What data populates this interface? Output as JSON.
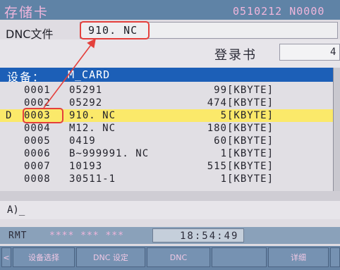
{
  "header": {
    "title": "存储卡",
    "program_no": "0510212 N0000"
  },
  "dnc": {
    "label": "DNC文件",
    "value": "910. NC"
  },
  "login": {
    "label": "登录书",
    "value": "4"
  },
  "device": {
    "label": "设备：",
    "name": "M_CARD"
  },
  "files": [
    {
      "mark": "",
      "num": "0001",
      "name": "05291",
      "size": "99",
      "unit": "[KBYTE]",
      "selected": false
    },
    {
      "mark": "",
      "num": "0002",
      "name": "05292",
      "size": "474",
      "unit": "[KBYTE]",
      "selected": false
    },
    {
      "mark": "D",
      "num": "0003",
      "name": "910. NC",
      "size": "5",
      "unit": "[KBYTE]",
      "selected": true
    },
    {
      "mark": "",
      "num": "0004",
      "name": "M12. NC",
      "size": "180",
      "unit": "[KBYTE]",
      "selected": false
    },
    {
      "mark": "",
      "num": "0005",
      "name": "0419",
      "size": "60",
      "unit": "[KBYTE]",
      "selected": false
    },
    {
      "mark": "",
      "num": "0006",
      "name": "B~999991. NC",
      "size": "1",
      "unit": "[KBYTE]",
      "selected": false
    },
    {
      "mark": "",
      "num": "0007",
      "name": "10193",
      "size": "515",
      "unit": "[KBYTE]",
      "selected": false
    },
    {
      "mark": "",
      "num": "0008",
      "name": "30511-1",
      "size": "1",
      "unit": "[KBYTE]",
      "selected": false
    }
  ],
  "command_line": "A)_",
  "status": {
    "mode": "RMT",
    "stars": "**** *** ***",
    "time": "18:54:49"
  },
  "softkeys": [
    {
      "label": "<"
    },
    {
      "label": "设备选择"
    },
    {
      "label": "DNC 设定"
    },
    {
      "label": "DNC"
    },
    {
      "label": ""
    },
    {
      "label": "详细"
    },
    {
      "label": ""
    }
  ],
  "colors": {
    "titlebar": "#5f83a6",
    "title_text": "#f0b6dc",
    "device_bar": "#1c5fb7",
    "selected_row": "#fbe96a",
    "annotation_red": "#e4403c"
  }
}
